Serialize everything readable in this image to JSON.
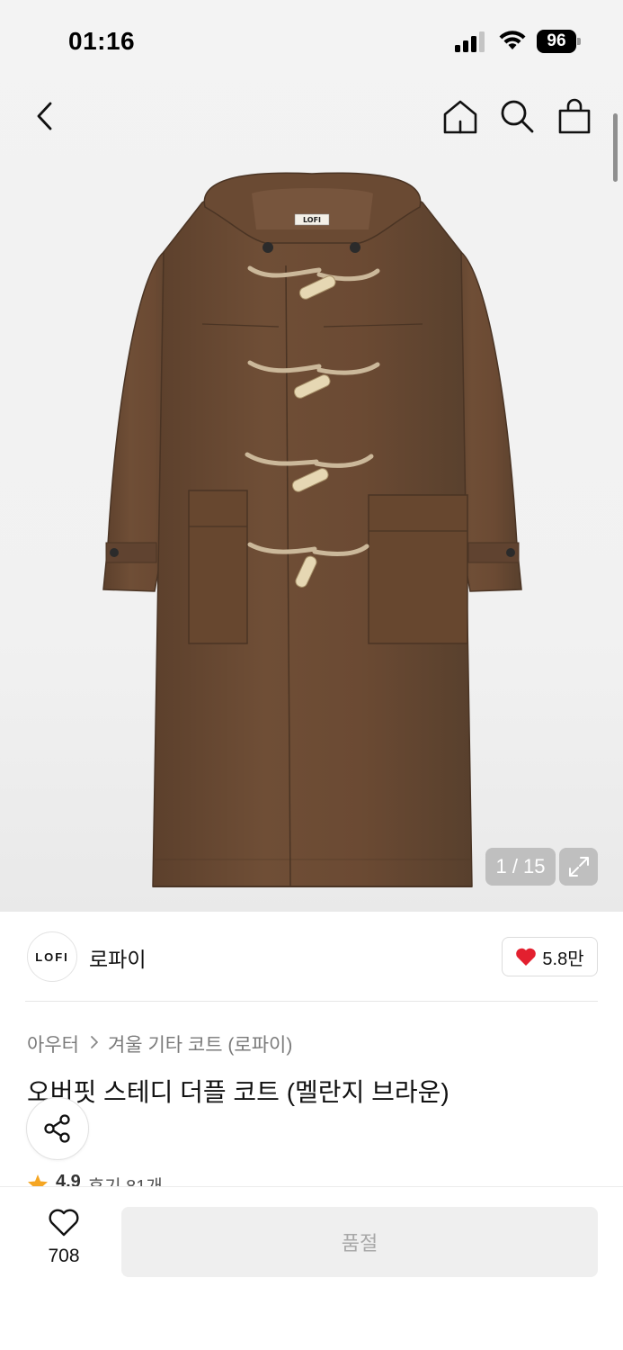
{
  "status_bar": {
    "time": "01:16",
    "battery": "96"
  },
  "nav": {
    "icons": [
      "back-icon",
      "home-icon",
      "search-icon",
      "shopping-bag-icon"
    ]
  },
  "gallery": {
    "counter": "1 / 15",
    "product_label": "LOFI"
  },
  "brand": {
    "logo_text": "LOFI",
    "name": "로파이",
    "likes": "5.8만"
  },
  "breadcrumb": {
    "category": "아우터",
    "subcategory": "겨울 기타 코트 (로파이)"
  },
  "product": {
    "title": "오버핏 스테디 더플 코트 (멜란지 브라운)"
  },
  "rating": {
    "score": "4.9",
    "reviews": "후기 81개"
  },
  "bottom": {
    "wish_count": "708",
    "buy_label": "품절"
  },
  "colors": {
    "accent_red": "#e3202f",
    "star": "#f5a623",
    "coat": "#6d4c35"
  }
}
